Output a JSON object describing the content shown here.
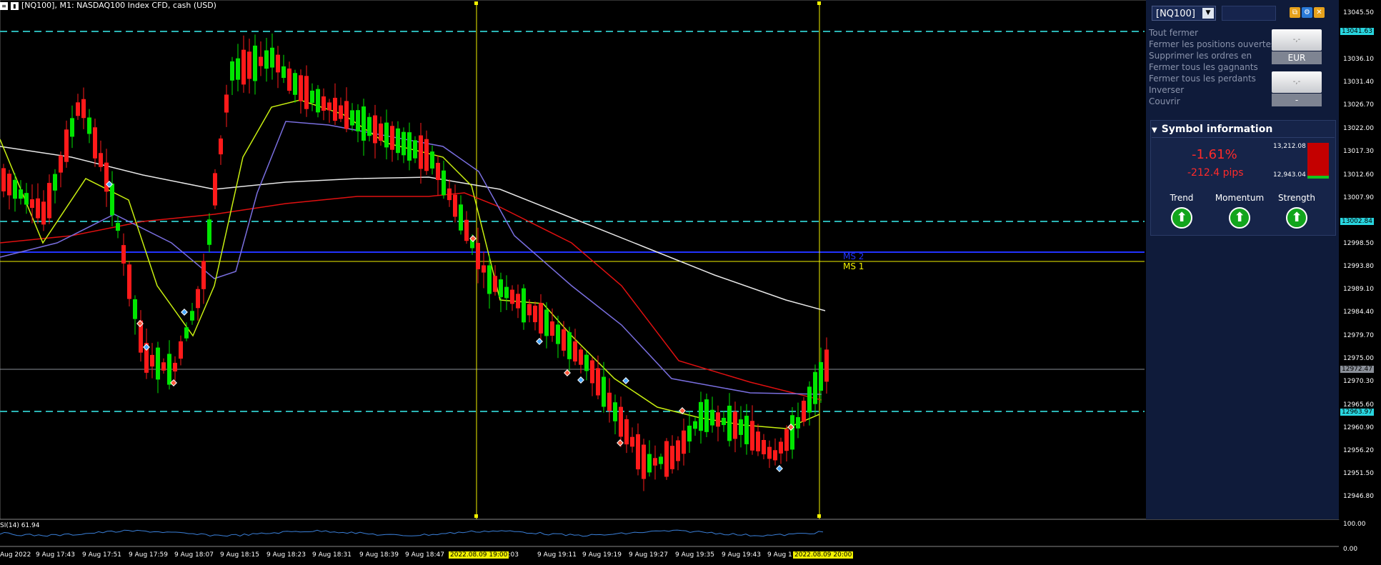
{
  "window": {
    "title": "[NQ100], M1:  NASDAQ100 Index CFD, cash (USD)"
  },
  "panel": {
    "symbol_select": "[NQ100]",
    "menu": [
      "Tout fermer",
      "Fermer les positions ouvertes",
      "Supprimer les ordres en",
      "Fermer tous les gagnants",
      "Fermer tous les perdants",
      "Inverser",
      "Couvrir"
    ],
    "btn1_top": "-,-",
    "btn1_bottom": "EUR",
    "btn2_top": "-,-",
    "btn2_bottom": "-",
    "symbol_info_title": "Symbol information",
    "change_pct": "-1.61%",
    "change_pips": "-212.4 pips",
    "range_high": "13,212.08",
    "range_low": "12,943.04",
    "trend_label": "Trend",
    "momentum_label": "Momentum",
    "strength_label": "Strength",
    "icons": [
      "copy-icon",
      "gear-icon",
      "close-icon",
      "caret-down-icon",
      "arrow-up-icon"
    ]
  },
  "y_axis": {
    "ticks": [
      "13045.50",
      "13040.80",
      "13036.10",
      "13031.40",
      "13026.70",
      "13022.00",
      "13017.30",
      "13012.60",
      "13007.90",
      "12998.50",
      "12993.80",
      "12989.10",
      "12984.40",
      "12979.70",
      "12975.00",
      "12970.30",
      "12965.60",
      "12960.90",
      "12956.20",
      "12951.50",
      "12946.80"
    ],
    "marker_top": "13041.63",
    "marker_mid": "13002.84",
    "marker_price": "12972.47",
    "marker_low": "12963.97"
  },
  "x_axis": {
    "ticks": [
      "Aug 2022",
      "9 Aug 17:43",
      "9 Aug 17:51",
      "9 Aug 17:59",
      "9 Aug 18:07",
      "9 Aug 18:15",
      "9 Aug 18:23",
      "9 Aug 18:31",
      "9 Aug 18:39",
      "9 Aug 18:47",
      "19:03",
      "9 Aug 19:11",
      "9 Aug 19:19",
      "9 Aug 19:27",
      "9 Aug 19:35",
      "9 Aug 19:43",
      "9 Aug 1"
    ],
    "highlight_left": "2022.08.09 19:00",
    "highlight_right": "2022.08.09 20:00"
  },
  "levels": {
    "ms2": "MS 2",
    "ms1": "MS 1"
  },
  "rsi": {
    "label": "SI(14) 61.94",
    "top": "100.00",
    "bottom": "0.00"
  },
  "colors": {
    "bull": "#00e600",
    "bear": "#ff1a1a",
    "cyan": "#2ab3b3",
    "yellow": "#f2f200",
    "panel": "#0f1b3a"
  }
}
